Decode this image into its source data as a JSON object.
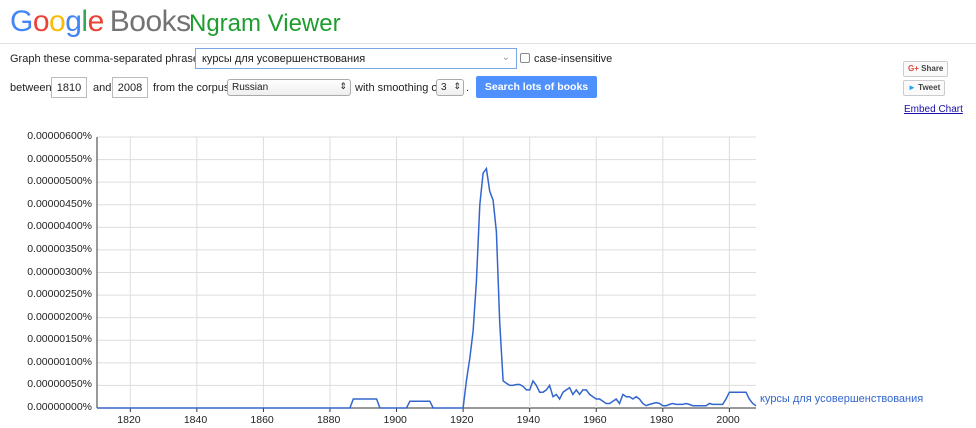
{
  "header": {
    "logo_letters": [
      "G",
      "o",
      "o",
      "g",
      "l",
      "e"
    ],
    "books": "Books",
    "viewer": "Ngram Viewer"
  },
  "form": {
    "phrases_label": "Graph these comma-separated phrases:",
    "phrase_value": "курсы для усовершенствования",
    "case_insensitive": "case-insensitive",
    "between_label": "between",
    "start_year": "1810",
    "and_label": "and",
    "end_year": "2008",
    "corpus_label": "from the corpus",
    "corpus_value": "Russian",
    "smoothing_label": "with smoothing of",
    "smoothing_value": "3",
    "period": ".",
    "search_button": "Search lots of books"
  },
  "share": {
    "share_label": "Share",
    "tweet_label": "Tweet",
    "embed_label": "Embed Chart"
  },
  "chart_data": {
    "type": "line",
    "x": [
      1810,
      1886,
      1887,
      1894,
      1895,
      1903,
      1904,
      1910,
      1911,
      1920,
      1921,
      1922,
      1923,
      1924,
      1925,
      1926,
      1927,
      1928,
      1929,
      1930,
      1931,
      1932,
      1933,
      1934,
      1935,
      1936,
      1937,
      1938,
      1939,
      1940,
      1941,
      1942,
      1943,
      1944,
      1945,
      1946,
      1947,
      1948,
      1949,
      1950,
      1951,
      1952,
      1953,
      1954,
      1955,
      1956,
      1957,
      1958,
      1959,
      1960,
      1961,
      1962,
      1963,
      1964,
      1965,
      1966,
      1967,
      1968,
      1969,
      1970,
      1971,
      1972,
      1973,
      1974,
      1975,
      1976,
      1977,
      1978,
      1979,
      1980,
      1981,
      1982,
      1983,
      1984,
      1985,
      1986,
      1987,
      1988,
      1989,
      1990,
      1991,
      1992,
      1993,
      1994,
      1995,
      1996,
      1997,
      1998,
      1999,
      2000,
      2001,
      2002,
      2003,
      2004,
      2005,
      2006,
      2007,
      2008
    ],
    "series": [
      {
        "name": "курсы для усовершенствования",
        "color": "#3366cc",
        "values": [
          0,
          0,
          2e-07,
          2e-07,
          0,
          0,
          1.5e-07,
          1.5e-07,
          0,
          0,
          6e-07,
          1.1e-06,
          1.7e-06,
          2.8e-06,
          4.5e-06,
          5.2e-06,
          5.3e-06,
          4.8e-06,
          4.6e-06,
          3.9e-06,
          1.9e-06,
          6e-07,
          5.5e-07,
          5e-07,
          5e-07,
          5.2e-07,
          5.2e-07,
          4.8e-07,
          4e-07,
          4e-07,
          6e-07,
          5e-07,
          3.5e-07,
          3.5e-07,
          4e-07,
          5e-07,
          2.5e-07,
          3e-07,
          2e-07,
          3.5e-07,
          4e-07,
          4.5e-07,
          3e-07,
          4e-07,
          3e-07,
          4e-07,
          4e-07,
          3e-07,
          2.5e-07,
          2e-07,
          2e-07,
          1.5e-07,
          1e-07,
          1e-07,
          1.5e-07,
          2e-07,
          1e-07,
          3e-07,
          2.5e-07,
          2.5e-07,
          2e-07,
          2.5e-07,
          2e-07,
          1e-07,
          5e-08,
          8e-08,
          1e-07,
          1.2e-07,
          1e-07,
          5e-08,
          5e-08,
          8e-08,
          1e-07,
          8e-08,
          8e-08,
          8e-08,
          1e-07,
          8e-08,
          5e-08,
          5e-08,
          5e-08,
          5e-08,
          5e-08,
          1e-07,
          8e-08,
          8e-08,
          8e-08,
          8e-08,
          2e-07,
          3.5e-07,
          3.5e-07,
          3.5e-07,
          3.5e-07,
          3.5e-07,
          3.5e-07,
          2e-07,
          1e-07,
          5e-08
        ]
      }
    ],
    "y_ticks": [
      "0.00000000%",
      "0.00000050%",
      "0.00000100%",
      "0.00000150%",
      "0.00000200%",
      "0.00000250%",
      "0.00000300%",
      "0.00000350%",
      "0.00000400%",
      "0.00000450%",
      "0.00000500%",
      "0.00000550%",
      "0.00000600%"
    ],
    "x_ticks": [
      "1820",
      "1840",
      "1860",
      "1880",
      "1900",
      "1920",
      "1940",
      "1960",
      "1980",
      "2000"
    ],
    "xlim": [
      1810,
      2008
    ],
    "ylim": [
      0,
      6e-06
    ],
    "grid": true
  }
}
